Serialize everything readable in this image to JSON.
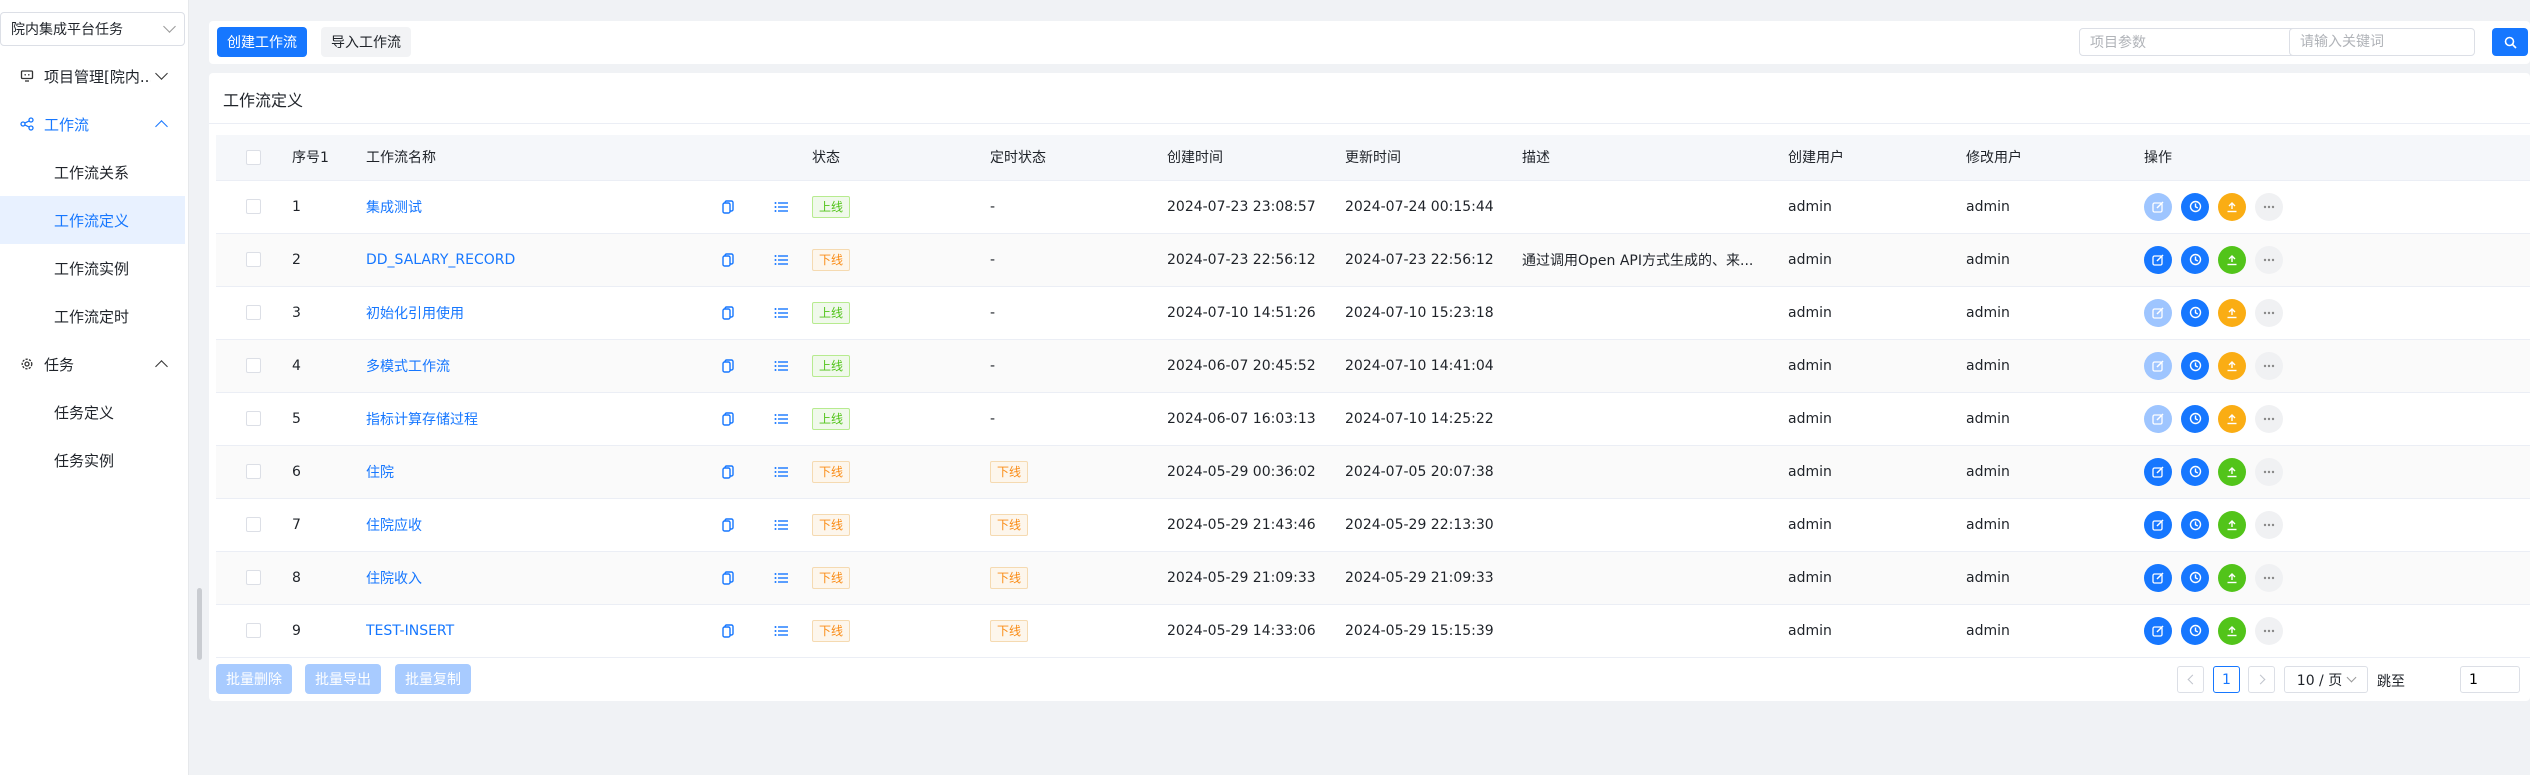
{
  "sidebar": {
    "project_select": "院内集成平台任务",
    "groups": [
      {
        "label": "项目管理[院内...",
        "icon": "monitor-icon"
      },
      {
        "label": "工作流",
        "icon": "share-nodes-icon"
      },
      {
        "label": "任务",
        "icon": "gear-icon"
      }
    ],
    "workflow_items": [
      "工作流关系",
      "工作流定义",
      "工作流实例",
      "工作流定时"
    ],
    "task_items": [
      "任务定义",
      "任务实例"
    ]
  },
  "toolbar": {
    "create_label": "创建工作流",
    "import_label": "导入工作流",
    "param_placeholder": "项目参数",
    "keyword_placeholder": "请输入关键词"
  },
  "panel": {
    "title": "工作流定义"
  },
  "table": {
    "headers": {
      "index": "序号1",
      "name": "工作流名称",
      "status": "状态",
      "schedule": "定时状态",
      "created": "创建时间",
      "updated": "更新时间",
      "desc": "描述",
      "creator": "创建用户",
      "modifier": "修改用户",
      "ops": "操作"
    },
    "rows": [
      {
        "index": "1",
        "name": "集成测试",
        "status": "上线",
        "schedule": "-",
        "created": "2024-07-23 23:08:57",
        "updated": "2024-07-24 00:15:44",
        "desc": "",
        "creator": "admin",
        "modifier": "admin"
      },
      {
        "index": "2",
        "name": "DD_SALARY_RECORD",
        "status": "下线",
        "schedule": "-",
        "created": "2024-07-23 22:56:12",
        "updated": "2024-07-23 22:56:12",
        "desc": "通过调用Open API方式生成的、来...",
        "creator": "admin",
        "modifier": "admin"
      },
      {
        "index": "3",
        "name": "初始化引用使用",
        "status": "上线",
        "schedule": "-",
        "created": "2024-07-10 14:51:26",
        "updated": "2024-07-10 15:23:18",
        "desc": "",
        "creator": "admin",
        "modifier": "admin"
      },
      {
        "index": "4",
        "name": "多模式工作流",
        "status": "上线",
        "schedule": "-",
        "created": "2024-06-07 20:45:52",
        "updated": "2024-07-10 14:41:04",
        "desc": "",
        "creator": "admin",
        "modifier": "admin"
      },
      {
        "index": "5",
        "name": "指标计算存储过程",
        "status": "上线",
        "schedule": "-",
        "created": "2024-06-07 16:03:13",
        "updated": "2024-07-10 14:25:22",
        "desc": "",
        "creator": "admin",
        "modifier": "admin"
      },
      {
        "index": "6",
        "name": "住院",
        "status": "下线",
        "schedule": "下线",
        "created": "2024-05-29 00:36:02",
        "updated": "2024-07-05 20:07:38",
        "desc": "",
        "creator": "admin",
        "modifier": "admin"
      },
      {
        "index": "7",
        "name": "住院应收",
        "status": "下线",
        "schedule": "下线",
        "created": "2024-05-29 21:43:46",
        "updated": "2024-05-29 22:13:30",
        "desc": "",
        "creator": "admin",
        "modifier": "admin"
      },
      {
        "index": "8",
        "name": "住院收入",
        "status": "下线",
        "schedule": "下线",
        "created": "2024-05-29 21:09:33",
        "updated": "2024-05-29 21:09:33",
        "desc": "",
        "creator": "admin",
        "modifier": "admin"
      },
      {
        "index": "9",
        "name": "TEST-INSERT",
        "status": "下线",
        "schedule": "下线",
        "created": "2024-05-29 14:33:06",
        "updated": "2024-05-29 15:15:39",
        "desc": "",
        "creator": "admin",
        "modifier": "admin"
      }
    ]
  },
  "footer": {
    "batch_delete": "批量删除",
    "batch_export": "批量导出",
    "batch_copy": "批量复制",
    "current_page": "1",
    "page_size": "10 / 页",
    "jump_label": "跳至",
    "jump_value": "1"
  },
  "colors": {
    "primary": "#1677ff",
    "online": "#52c41a",
    "offline": "#fa8c16"
  }
}
